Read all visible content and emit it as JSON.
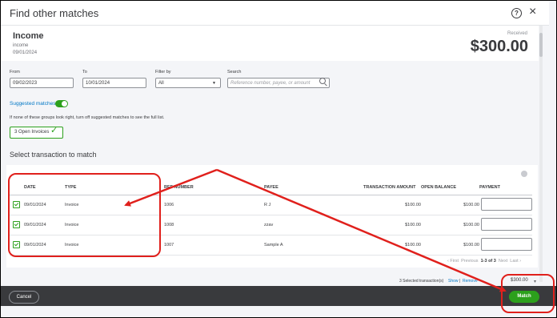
{
  "dialog": {
    "title": "Find other matches",
    "help_icon": "?",
    "close_icon": "×"
  },
  "transaction": {
    "name": "Income",
    "subtitle": "income",
    "date": "09/01/2024",
    "amount_label": "Received",
    "amount": "$300.00"
  },
  "filters": {
    "from_label": "From",
    "from_value": "09/02/2023",
    "to_label": "To",
    "to_value": "10/01/2024",
    "filterby_label": "Filter by",
    "filterby_value": "All",
    "search_label": "Search",
    "search_placeholder": "Reference number, payee, or amount"
  },
  "suggested": {
    "label": "Suggested matches",
    "hint": "If none of these groups look right, turn off suggested matches to see the full list.",
    "chip": "3 Open Invoices"
  },
  "select_title": "Select transaction to match",
  "table": {
    "headers": {
      "date": "DATE",
      "type": "TYPE",
      "ref": "REF NUMBER",
      "payee": "PAYEE",
      "txn_amount": "TRANSACTION AMOUNT",
      "open_balance": "OPEN BALANCE",
      "payment": "PAYMENT"
    },
    "rows": [
      {
        "date": "09/01/2024",
        "type": "Invoice",
        "ref": "1006",
        "payee": "R J",
        "amount": "$100.00",
        "balance": "$100.00"
      },
      {
        "date": "09/01/2024",
        "type": "Invoice",
        "ref": "1008",
        "payee": "zzav",
        "amount": "$100.00",
        "balance": "$100.00"
      },
      {
        "date": "09/01/2024",
        "type": "Invoice",
        "ref": "1007",
        "payee": "Sample A",
        "amount": "$100.00",
        "balance": "$100.00"
      }
    ]
  },
  "pager": {
    "first": "‹ First",
    "previous": "Previous",
    "range": "1-3 of 3",
    "next": "Next",
    "last": "Last ›"
  },
  "footer": {
    "selected": "3 Selected transaction(s)",
    "show": "Show",
    "separator": "|",
    "remove": "Remove",
    "total": "$300.00"
  },
  "actions": {
    "cancel": "Cancel",
    "match": "Match"
  },
  "colors": {
    "accent_green": "#2ca01c",
    "link_blue": "#0077c5",
    "annotation_red": "#e0201c"
  }
}
